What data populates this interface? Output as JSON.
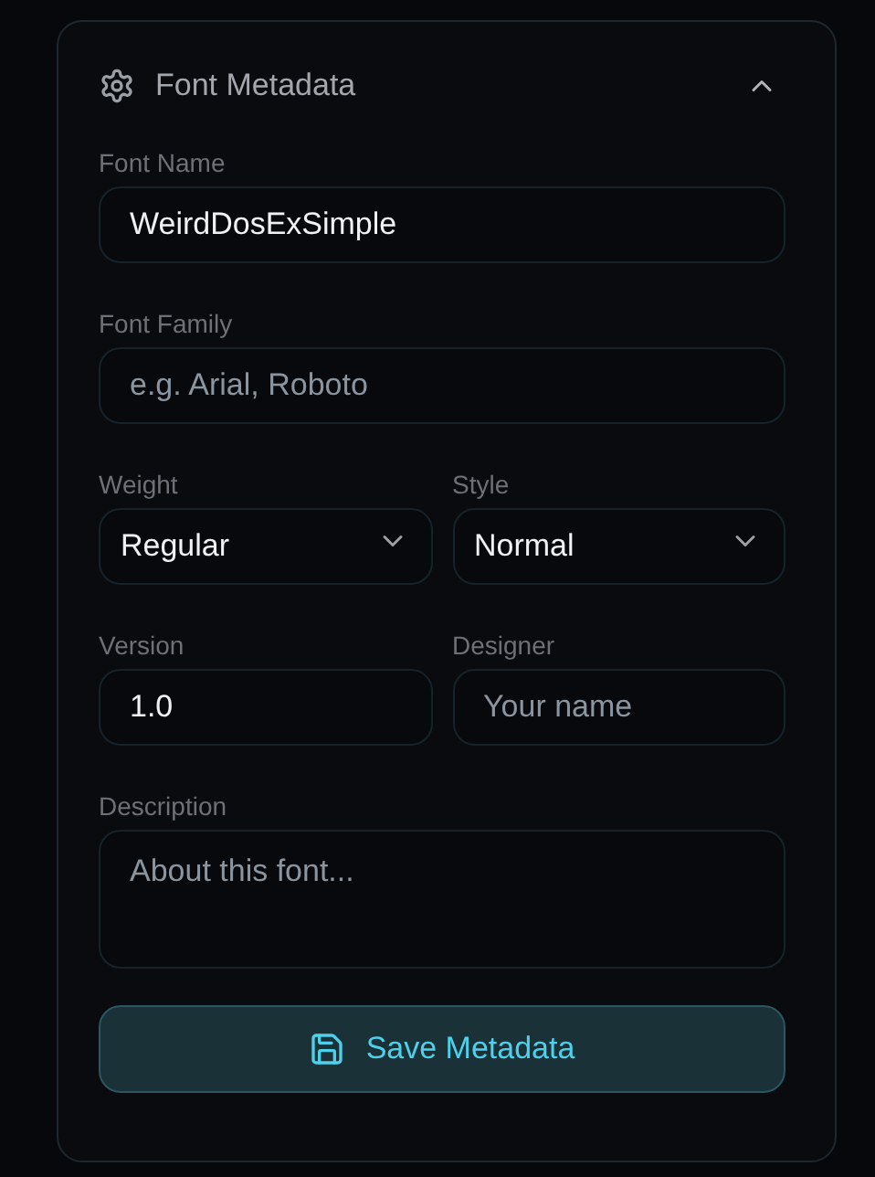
{
  "panel": {
    "title": "Font Metadata",
    "expanded": true
  },
  "rows": [
    [
      {
        "label": "Font Name",
        "kind": "input",
        "value": "WeirdDosExSimple"
      }
    ],
    [
      {
        "label": "Font Family",
        "kind": "input",
        "placeholder": "e.g. Arial, Roboto"
      }
    ],
    [
      {
        "label": "Weight",
        "kind": "select",
        "value": "Regular"
      },
      {
        "label": "Style",
        "kind": "select",
        "value": "Normal"
      }
    ],
    [
      {
        "label": "Version",
        "kind": "input",
        "value": "1.0"
      },
      {
        "label": "Designer",
        "kind": "input",
        "placeholder": "Your name"
      }
    ],
    [
      {
        "label": "Description",
        "kind": "textarea",
        "placeholder": "About this font..."
      }
    ]
  ],
  "save_button": {
    "label": "Save Metadata"
  }
}
